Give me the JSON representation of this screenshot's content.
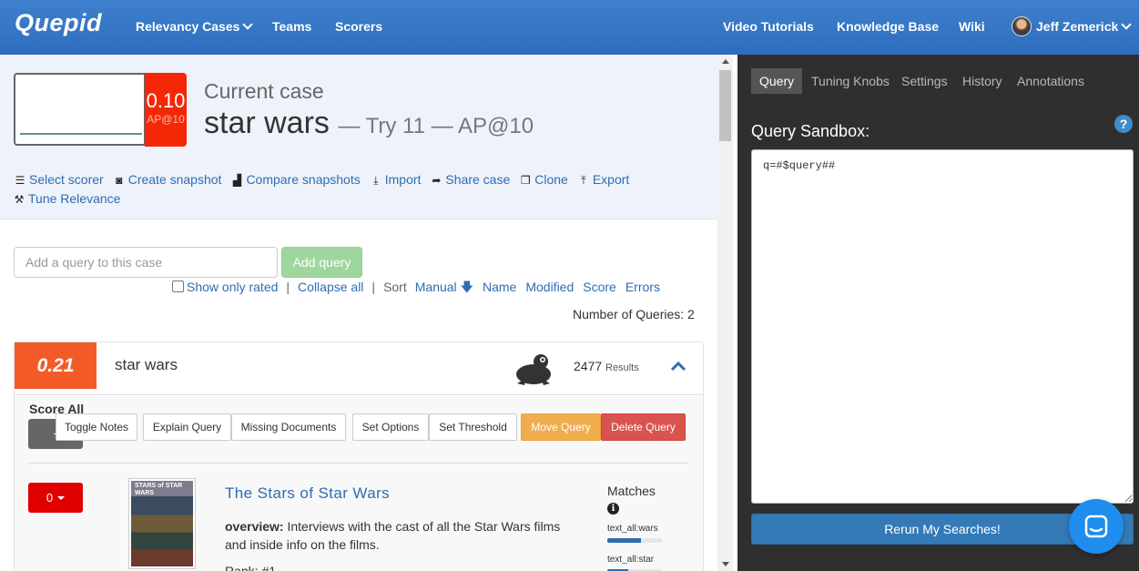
{
  "navbar": {
    "brand": "Quepid",
    "links": {
      "relevancy_cases": "Relevancy Cases",
      "teams": "Teams",
      "scorers": "Scorers",
      "video_tutorials": "Video Tutorials",
      "knowledge_base": "Knowledge Base",
      "wiki": "Wiki",
      "user": "Jeff Zemerick"
    }
  },
  "case": {
    "score": "0.10",
    "scorer": "AP@10",
    "current_case_label": "Current case",
    "name": "star wars",
    "subtitle": "— Try 11 — AP@10",
    "actions": {
      "select_scorer": "Select scorer",
      "create_snapshot": "Create snapshot",
      "compare_snapshots": "Compare snapshots",
      "import": "Import",
      "share_case": "Share case",
      "clone": "Clone",
      "export": "Export",
      "tune_relevance": "Tune Relevance"
    }
  },
  "query_controls": {
    "add_placeholder": "Add a query to this case",
    "add_button": "Add query",
    "show_only_rated": "Show only rated",
    "collapse_all": "Collapse all",
    "sep": "|",
    "sort_label": "Sort",
    "sort_manual": "Manual",
    "sort_name": "Name",
    "sort_modified": "Modified",
    "sort_score": "Score",
    "sort_errors": "Errors",
    "number_of_queries": "Number of Queries: 2"
  },
  "query": {
    "score": "0.21",
    "text": "star wars",
    "results_count": "2477",
    "results_label": "Results",
    "score_all_label": "Score All",
    "score_all_value": "-",
    "buttons": {
      "toggle_notes": "Toggle Notes",
      "explain_query": "Explain Query",
      "missing_documents": "Missing Documents",
      "set_options": "Set Options",
      "set_threshold": "Set Threshold",
      "move_query": "Move Query",
      "delete_query": "Delete Query"
    },
    "doc": {
      "rating": "0",
      "thumb_text": "STARS of STAR WARS",
      "title": "The Stars of Star Wars",
      "overview_label": "overview:",
      "overview": "Interviews with the cast of all the Star Wars films and inside info on the films.",
      "rank": "Rank: #1",
      "matches_label": "Matches",
      "matches": [
        {
          "field": "text_all:wars",
          "fraction": 0.62
        },
        {
          "field": "text_all:star",
          "fraction": 0.38
        }
      ]
    }
  },
  "sandbox": {
    "tabs": {
      "query": "Query",
      "tuning_knobs": "Tuning Knobs",
      "settings": "Settings",
      "history": "History",
      "annotations": "Annotations"
    },
    "label": "Query Sandbox:",
    "value": "q=#$query##",
    "rerun_button": "Rerun My Searches!"
  },
  "colors": {
    "navbar": "#3478c6",
    "case_score": "#f42806",
    "query_score": "#f25b28",
    "rating": "#e00000",
    "add_query": "#9fd69e",
    "move_query": "#f0ad4e",
    "delete_query": "#d9534f",
    "rerun": "#337ab7",
    "sandbox_bg": "#2f2f2f"
  },
  "icons": {
    "dropdown": "chevron-down-icon",
    "select_scorer": "list-icon",
    "create_snapshot": "camera-icon",
    "compare_snapshots": "bar-chart-icon",
    "import": "download-icon",
    "share_case": "share-arrow-icon",
    "clone": "copy-icon",
    "export": "upload-icon",
    "tune_relevance": "wrench-icon",
    "sort_direction": "arrow-down-icon",
    "search_engine": "frog-icon",
    "collapse": "chevron-up-icon",
    "help": "question-circle-icon",
    "info": "info-circle-icon",
    "chat": "chat-icon"
  }
}
